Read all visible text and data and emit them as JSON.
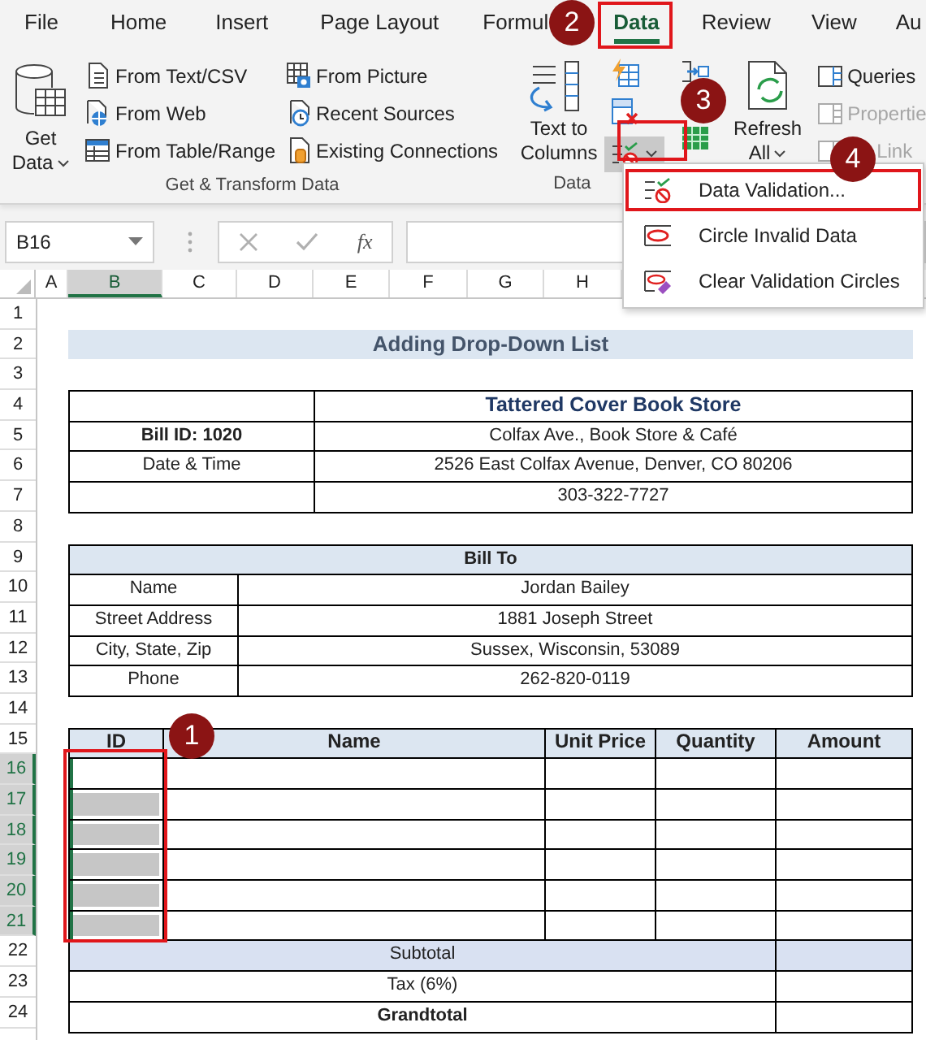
{
  "ribbon_tabs": [
    {
      "label": "File",
      "selected": false
    },
    {
      "label": "Home",
      "selected": false
    },
    {
      "label": "Insert",
      "selected": false
    },
    {
      "label": "Page Layout",
      "selected": false
    },
    {
      "label": "Formul",
      "selected": false
    },
    {
      "label": "Data",
      "selected": true
    },
    {
      "label": "Review",
      "selected": false
    },
    {
      "label": "View",
      "selected": false
    },
    {
      "label": "Au",
      "selected": false
    }
  ],
  "ribbon": {
    "get_data": "Get Data",
    "get_items_left": [
      "From Text/CSV",
      "From Web",
      "From Table/Range"
    ],
    "get_items_right": [
      "From Picture",
      "Recent Sources",
      "Existing Connections"
    ],
    "get_group_label": "Get & Transform Data",
    "text_to_columns": "Text to Columns",
    "data_validation_button": {
      "selected": true
    },
    "data_group_label": "Data",
    "refresh": "Refresh All",
    "query_items": [
      {
        "label": "Queries",
        "disabled": false
      },
      {
        "label": "Propertie",
        "disabled": true
      },
      {
        "label": "Link",
        "disabled": true
      }
    ]
  },
  "formula_bar": {
    "name_box": "B16",
    "function_label": "fx"
  },
  "columns": [
    {
      "label": "A",
      "selected": false
    },
    {
      "label": "B",
      "selected": true
    },
    {
      "label": "C",
      "selected": false
    },
    {
      "label": "D",
      "selected": false
    },
    {
      "label": "E",
      "selected": false
    },
    {
      "label": "F",
      "selected": false
    },
    {
      "label": "G",
      "selected": false
    },
    {
      "label": "H",
      "selected": false
    }
  ],
  "row_numbers": [
    {
      "label": "1",
      "selected": false
    },
    {
      "label": "2",
      "selected": false
    },
    {
      "label": "3",
      "selected": false
    },
    {
      "label": "4",
      "selected": false
    },
    {
      "label": "5",
      "selected": false
    },
    {
      "label": "6",
      "selected": false
    },
    {
      "label": "7",
      "selected": false
    },
    {
      "label": "8",
      "selected": false
    },
    {
      "label": "9",
      "selected": false
    },
    {
      "label": "10",
      "selected": false
    },
    {
      "label": "11",
      "selected": false
    },
    {
      "label": "12",
      "selected": false
    },
    {
      "label": "13",
      "selected": false
    },
    {
      "label": "14",
      "selected": false
    },
    {
      "label": "15",
      "selected": false
    },
    {
      "label": "16",
      "selected": true
    },
    {
      "label": "17",
      "selected": true
    },
    {
      "label": "18",
      "selected": true
    },
    {
      "label": "19",
      "selected": true
    },
    {
      "label": "20",
      "selected": true
    },
    {
      "label": "21",
      "selected": true
    },
    {
      "label": "22",
      "selected": false
    },
    {
      "label": "23",
      "selected": false
    },
    {
      "label": "24",
      "selected": false
    }
  ],
  "sheet": {
    "title": "Adding Drop-Down List",
    "store_rows": [
      {
        "kind": "heading",
        "right": "Tattered Cover Book Store"
      },
      {
        "kind": "plain",
        "left": "Bill ID: 1020",
        "left_bold": true,
        "right": "Colfax Ave., Book Store & Café"
      },
      {
        "kind": "plain",
        "left": "Date & Time",
        "left_bold": false,
        "right": "2526 East Colfax Avenue, Denver, CO 80206"
      },
      {
        "kind": "plain",
        "right": "303-322-7727"
      }
    ],
    "bill_to": {
      "title": "Bill To",
      "rows": [
        {
          "label": "Name",
          "value": "Jordan Bailey"
        },
        {
          "label": "Street Address",
          "value": "1881 Joseph Street"
        },
        {
          "label": "City, State, Zip",
          "value": "Sussex, Wisconsin, 53089"
        },
        {
          "label": "Phone",
          "value": "262-820-0119"
        }
      ]
    },
    "items": {
      "columns": [
        "ID",
        "Name",
        "Unit Price",
        "Quantity",
        "Amount"
      ],
      "rows": [
        {
          "selected": true,
          "active": true
        },
        {
          "selected": true,
          "active": false
        },
        {
          "selected": true,
          "active": false
        },
        {
          "selected": true,
          "active": false
        },
        {
          "selected": true,
          "active": false
        },
        {
          "selected": true,
          "active": false
        }
      ],
      "totals": [
        {
          "label": "Subtotal",
          "kind": "shaded"
        },
        {
          "label": "Tax (6%)",
          "kind": "plain"
        },
        {
          "label": "Grandtotal",
          "kind": "bold"
        }
      ]
    }
  },
  "menu": {
    "items": [
      {
        "label": "Data Validation...",
        "selected": true
      },
      {
        "label": "Circle Invalid Data",
        "selected": false
      },
      {
        "label": "Clear Validation Circles",
        "selected": false
      }
    ]
  },
  "callouts": [
    "2",
    "3",
    "4",
    "1"
  ]
}
